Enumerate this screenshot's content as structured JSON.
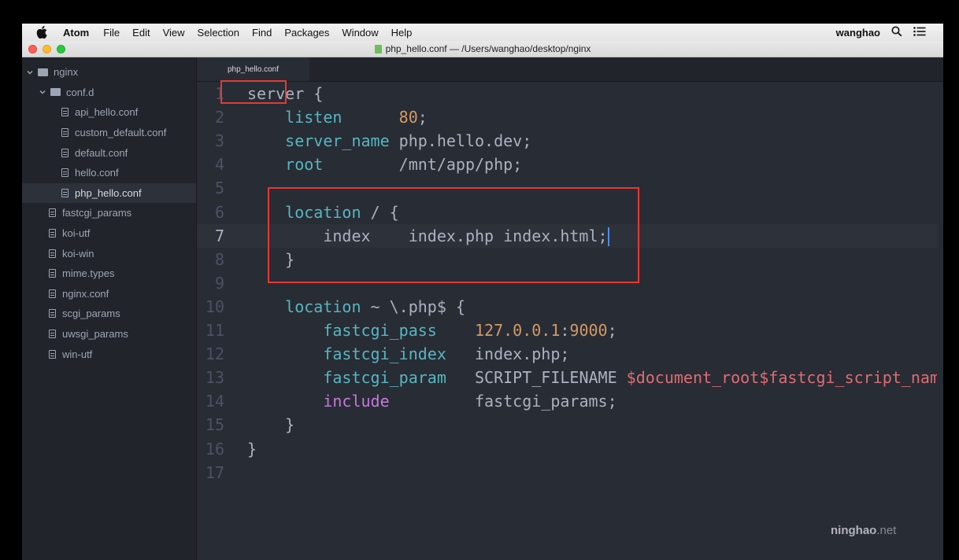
{
  "menubar": {
    "app_name": "Atom",
    "items": [
      "File",
      "Edit",
      "View",
      "Selection",
      "Find",
      "Packages",
      "Window",
      "Help"
    ],
    "user": "wanghao"
  },
  "titlebar": {
    "title": "php_hello.conf — /Users/wanghao/desktop/nginx"
  },
  "sidebar": {
    "root": "nginx",
    "folder": "conf.d",
    "folder_files": [
      "api_hello.conf",
      "custom_default.conf",
      "default.conf",
      "hello.conf",
      "php_hello.conf"
    ],
    "selected": "php_hello.conf",
    "root_files": [
      "fastcgi_params",
      "koi-utf",
      "koi-win",
      "mime.types",
      "nginx.conf",
      "scgi_params",
      "uwsgi_params",
      "win-utf"
    ]
  },
  "editor": {
    "tab_label": "php_hello.conf",
    "cursor_line": 7,
    "lines": [
      {
        "n": "1",
        "tokens": [
          {
            "t": "plain",
            "v": "server {"
          }
        ]
      },
      {
        "n": "2",
        "tokens": [
          {
            "t": "plain",
            "v": "    "
          },
          {
            "t": "kw",
            "v": "listen"
          },
          {
            "t": "plain",
            "v": "      "
          },
          {
            "t": "num",
            "v": "80"
          },
          {
            "t": "plain",
            "v": ";"
          }
        ]
      },
      {
        "n": "3",
        "tokens": [
          {
            "t": "plain",
            "v": "    "
          },
          {
            "t": "kw",
            "v": "server_name"
          },
          {
            "t": "plain",
            "v": " php.hello.dev;"
          }
        ]
      },
      {
        "n": "4",
        "tokens": [
          {
            "t": "plain",
            "v": "    "
          },
          {
            "t": "kw",
            "v": "root"
          },
          {
            "t": "plain",
            "v": "        /mnt/app/php;"
          }
        ]
      },
      {
        "n": "5",
        "tokens": []
      },
      {
        "n": "6",
        "tokens": [
          {
            "t": "plain",
            "v": "    "
          },
          {
            "t": "kw",
            "v": "location"
          },
          {
            "t": "plain",
            "v": " / {"
          }
        ]
      },
      {
        "n": "7",
        "tokens": [
          {
            "t": "plain",
            "v": "        index    index.php index.html;"
          }
        ]
      },
      {
        "n": "8",
        "tokens": [
          {
            "t": "plain",
            "v": "    }"
          }
        ]
      },
      {
        "n": "9",
        "tokens": []
      },
      {
        "n": "10",
        "tokens": [
          {
            "t": "plain",
            "v": "    "
          },
          {
            "t": "kw",
            "v": "location"
          },
          {
            "t": "plain",
            "v": " ~ \\.php$ {"
          }
        ]
      },
      {
        "n": "11",
        "tokens": [
          {
            "t": "plain",
            "v": "        "
          },
          {
            "t": "kw",
            "v": "fastcgi_pass"
          },
          {
            "t": "plain",
            "v": "    "
          },
          {
            "t": "num",
            "v": "127.0.0.1"
          },
          {
            "t": "plain",
            "v": ":"
          },
          {
            "t": "num",
            "v": "9000"
          },
          {
            "t": "plain",
            "v": ";"
          }
        ]
      },
      {
        "n": "12",
        "tokens": [
          {
            "t": "plain",
            "v": "        "
          },
          {
            "t": "kw",
            "v": "fastcgi_index"
          },
          {
            "t": "plain",
            "v": "   index.php;"
          }
        ]
      },
      {
        "n": "13",
        "tokens": [
          {
            "t": "plain",
            "v": "        "
          },
          {
            "t": "kw",
            "v": "fastcgi_param"
          },
          {
            "t": "plain",
            "v": "   SCRIPT_FILENAME "
          },
          {
            "t": "var",
            "v": "$document_root$fastcgi_script_nam"
          }
        ]
      },
      {
        "n": "14",
        "tokens": [
          {
            "t": "plain",
            "v": "        "
          },
          {
            "t": "include",
            "v": "include"
          },
          {
            "t": "plain",
            "v": "         fastcgi_params;"
          }
        ]
      },
      {
        "n": "15",
        "tokens": [
          {
            "t": "plain",
            "v": "    }"
          }
        ]
      },
      {
        "n": "16",
        "tokens": [
          {
            "t": "plain",
            "v": "}"
          }
        ]
      },
      {
        "n": "17",
        "tokens": []
      }
    ]
  },
  "watermark": {
    "brand": "ninghao",
    "tld": ".net"
  },
  "colors": {
    "highlight_box": "#e53935",
    "keyword": "#56b6c2",
    "number": "#d19a66",
    "variable": "#e06c75",
    "include": "#c678dd",
    "cursor": "#528bff"
  }
}
